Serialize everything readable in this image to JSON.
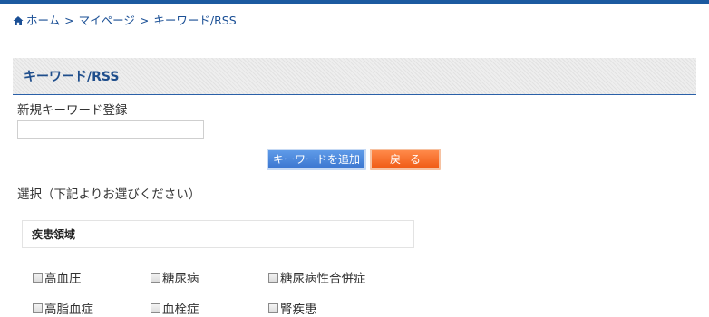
{
  "breadcrumb": {
    "home": "ホーム",
    "separator": ">",
    "mypage": "マイページ",
    "current": "キーワード/RSS"
  },
  "section": {
    "title": "キーワード/RSS"
  },
  "new_keyword": {
    "label": "新規キーワード登録",
    "value": "",
    "placeholder": ""
  },
  "buttons": {
    "add": "キーワードを追加",
    "back": "戻る"
  },
  "select_label": "選択（下記よりお選びください）",
  "category": {
    "title": "疾患領域",
    "options": [
      {
        "label": "高血圧",
        "checked": false
      },
      {
        "label": "糖尿病",
        "checked": false
      },
      {
        "label": "糖尿病性合併症",
        "checked": false
      },
      {
        "label": "高脂血症",
        "checked": false
      },
      {
        "label": "血栓症",
        "checked": false
      },
      {
        "label": "腎疾患",
        "checked": false
      }
    ]
  },
  "colors": {
    "accent": "#1c5aa0",
    "link": "#1a4f95",
    "button_add": "#4a86dc",
    "button_back": "#f26b24"
  },
  "icons": {
    "breadcrumb_home": "home-icon"
  }
}
